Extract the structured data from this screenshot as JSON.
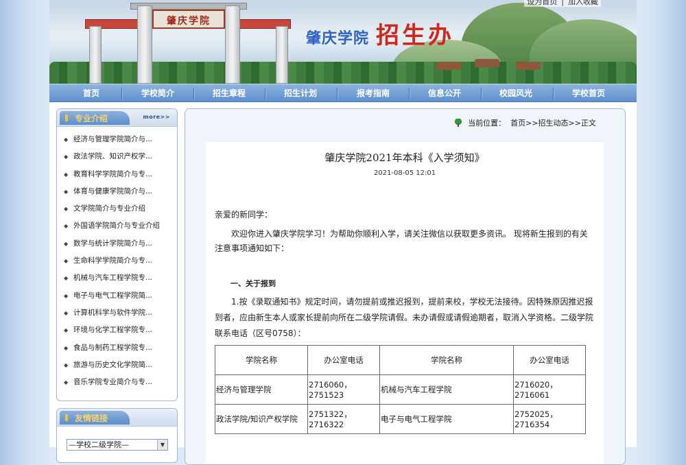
{
  "header": {
    "toplinks": [
      "设为首页",
      "|",
      "加入收藏"
    ],
    "gate_plaque": "肇庆学院",
    "school_name": "肇庆学院",
    "office_name": "招生办"
  },
  "nav": {
    "items": [
      "首页",
      "学校简介",
      "招生章程",
      "招生计划",
      "报考指南",
      "信息公开",
      "校园风光",
      "学校首页"
    ]
  },
  "sidebar": {
    "majors_title": "专业介绍",
    "more_label": "more>>",
    "majors": [
      "经济与管理学院简介与...",
      "政法学院、知识产权学...",
      "教育科学学院简介与专...",
      "体育与健康学院简介与...",
      "文学院简介与专业介绍",
      "外国语学院简介与专业介绍",
      "数学与统计学院简介与...",
      "生命科学学院简介与专...",
      "机械与汽车工程学院专...",
      "电子与电气工程学院简...",
      "计算机科学与软件学院...",
      "环境与化学工程学院专...",
      "食品与制药工程学院专...",
      "旅游与历史文化学院简...",
      "音乐学院专业简介与专..."
    ],
    "links_title": "友情链接",
    "links_select_value": "—学校二级学院—"
  },
  "breadcrumb": {
    "label": "当前位置：",
    "path": "首页>>招生动态>>正文"
  },
  "article": {
    "title": "肇庆学院2021年本科《入学须知》",
    "date": "2021-08-05 12:01",
    "greeting": "亲爱的新同学：",
    "intro": "欢迎你进入肇庆学院学习！为帮助你顺利入学，请关注微信以获取更多资讯。 现将新生报到的有关注意事项通知如下：",
    "section1": "一、关于报到",
    "para1": "1.按《录取通知书》规定时间，请勿提前或推迟报到，提前来校，学校无法接待。因特殊原因推迟报到者，应由新生本人或家长提前向所在二级学院请假。未办请假或请假逾期者，取消入学资格。二级学院联系电话（区号0758）：",
    "table": {
      "headers": [
        "学院名称",
        "办公室电话",
        "学院名称",
        "办公室电话"
      ],
      "rows": [
        [
          "经济与管理学院",
          "2716060，2751523",
          "机械与汽车工程学院",
          "2716020，2716061"
        ],
        [
          "政法学院/知识产权学院",
          "2751322，2716322",
          "电子与电气工程学院",
          "2752025，2716354"
        ]
      ]
    }
  }
}
